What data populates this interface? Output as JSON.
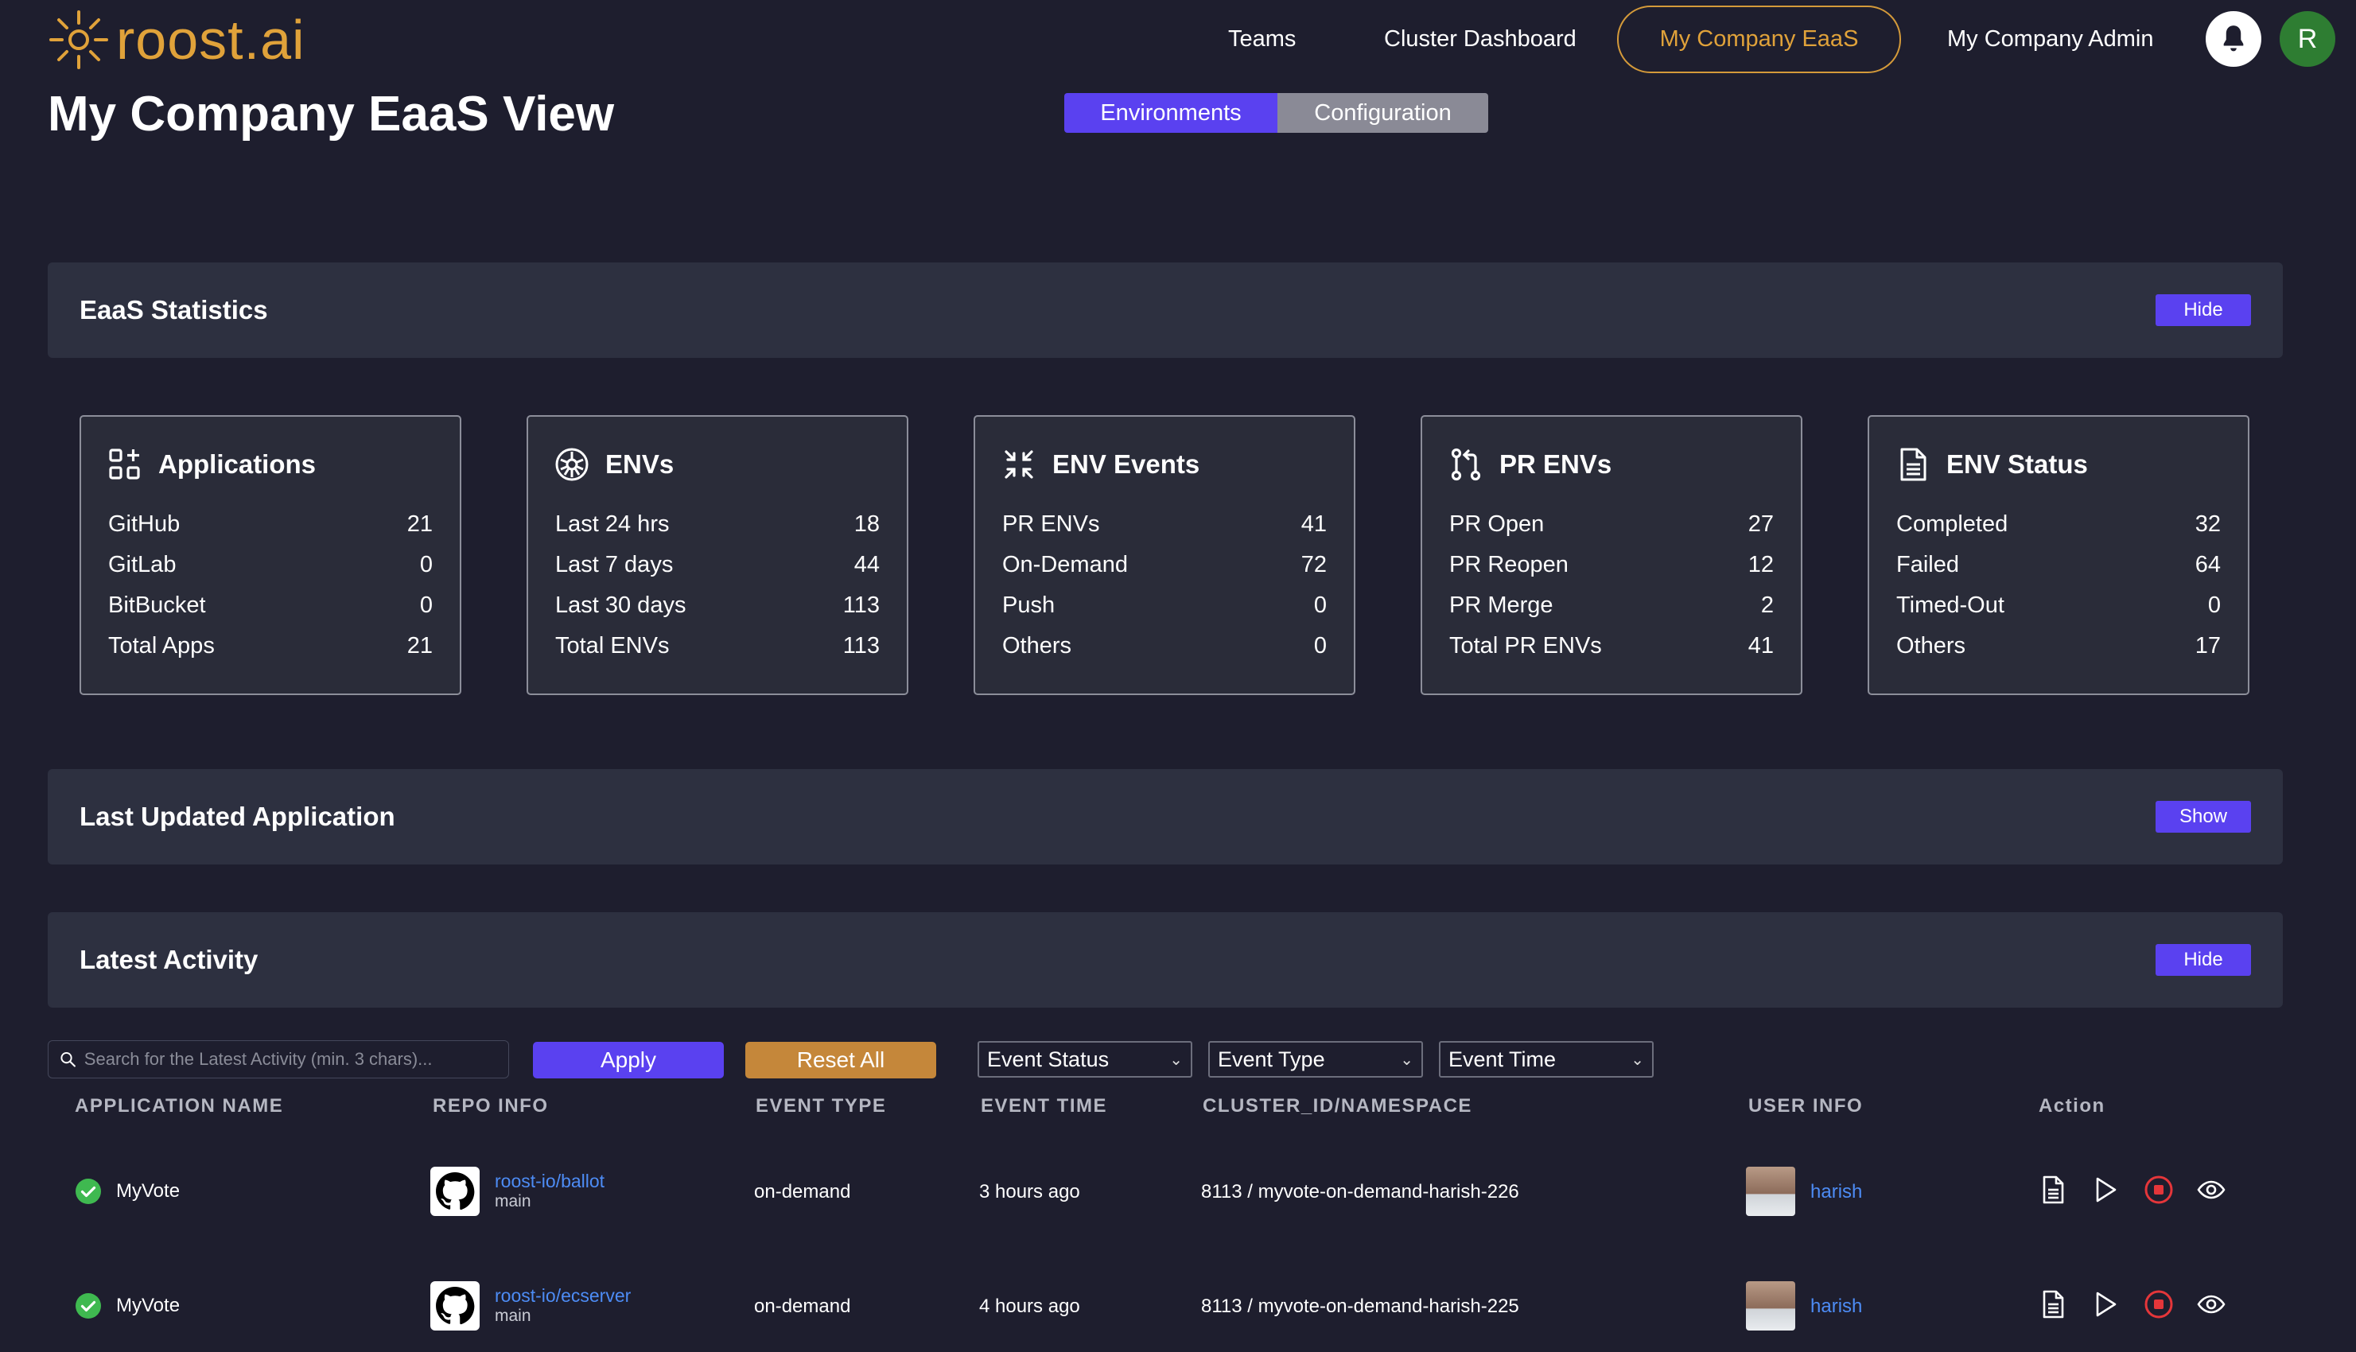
{
  "brand": {
    "name": "roost.ai",
    "color": "#e0a23a"
  },
  "nav": {
    "teams": "Teams",
    "cluster_dashboard": "Cluster Dashboard",
    "eaas": "My Company EaaS",
    "admin": "My Company Admin",
    "avatar_initial": "R"
  },
  "page": {
    "title": "My Company EaaS View",
    "tabs": {
      "environments": "Environments",
      "configuration": "Configuration"
    }
  },
  "stats_section": {
    "title": "EaaS Statistics",
    "toggle": "Hide"
  },
  "cards": [
    {
      "icon": "apps-icon",
      "title": "Applications",
      "rows": [
        {
          "label": "GitHub",
          "value": "21"
        },
        {
          "label": "GitLab",
          "value": "0"
        },
        {
          "label": "BitBucket",
          "value": "0"
        },
        {
          "label": "Total Apps",
          "value": "21"
        }
      ]
    },
    {
      "icon": "kubernetes-icon",
      "title": "ENVs",
      "rows": [
        {
          "label": "Last 24 hrs",
          "value": "18"
        },
        {
          "label": "Last 7 days",
          "value": "44"
        },
        {
          "label": "Last 30 days",
          "value": "113"
        },
        {
          "label": "Total ENVs",
          "value": "113"
        }
      ]
    },
    {
      "icon": "events-icon",
      "title": "ENV Events",
      "rows": [
        {
          "label": "PR ENVs",
          "value": "41"
        },
        {
          "label": "On-Demand",
          "value": "72"
        },
        {
          "label": "Push",
          "value": "0"
        },
        {
          "label": "Others",
          "value": "0"
        }
      ]
    },
    {
      "icon": "pull-request-icon",
      "title": "PR ENVs",
      "rows": [
        {
          "label": "PR Open",
          "value": "27"
        },
        {
          "label": "PR Reopen",
          "value": "12"
        },
        {
          "label": "PR Merge",
          "value": "2"
        },
        {
          "label": "Total PR ENVs",
          "value": "41"
        }
      ]
    },
    {
      "icon": "document-icon",
      "title": "ENV Status",
      "rows": [
        {
          "label": "Completed",
          "value": "32"
        },
        {
          "label": "Failed",
          "value": "64"
        },
        {
          "label": "Timed-Out",
          "value": "0"
        },
        {
          "label": "Others",
          "value": "17"
        }
      ]
    }
  ],
  "last_updated_section": {
    "title": "Last Updated Application",
    "toggle": "Show"
  },
  "activity_section": {
    "title": "Latest Activity",
    "toggle": "Hide"
  },
  "filters": {
    "search_placeholder": "Search for the Latest Activity (min. 3 chars)...",
    "apply": "Apply",
    "reset": "Reset All",
    "event_status": "Event Status",
    "event_type": "Event Type",
    "event_time": "Event Time"
  },
  "table": {
    "headers": {
      "app": "APPLICATION NAME",
      "repo": "REPO INFO",
      "type": "EVENT TYPE",
      "time": "EVENT TIME",
      "cluster": "CLUSTER_ID/NAMESPACE",
      "user": "USER INFO",
      "action": "Action"
    },
    "rows": [
      {
        "app": "MyVote",
        "repo": "roost-io/ballot",
        "branch": "main",
        "type": "on-demand",
        "time": "3 hours ago",
        "cluster": "8113 / myvote-on-demand-harish-226",
        "user": "harish"
      },
      {
        "app": "MyVote",
        "repo": "roost-io/ecserver",
        "branch": "main",
        "type": "on-demand",
        "time": "4 hours ago",
        "cluster": "8113 / myvote-on-demand-harish-225",
        "user": "harish"
      }
    ]
  },
  "colors": {
    "accent": "#5a41f0",
    "orange": "#c5873a",
    "success": "#3fb950",
    "danger": "#e5363a",
    "link": "#4d8cf5"
  }
}
